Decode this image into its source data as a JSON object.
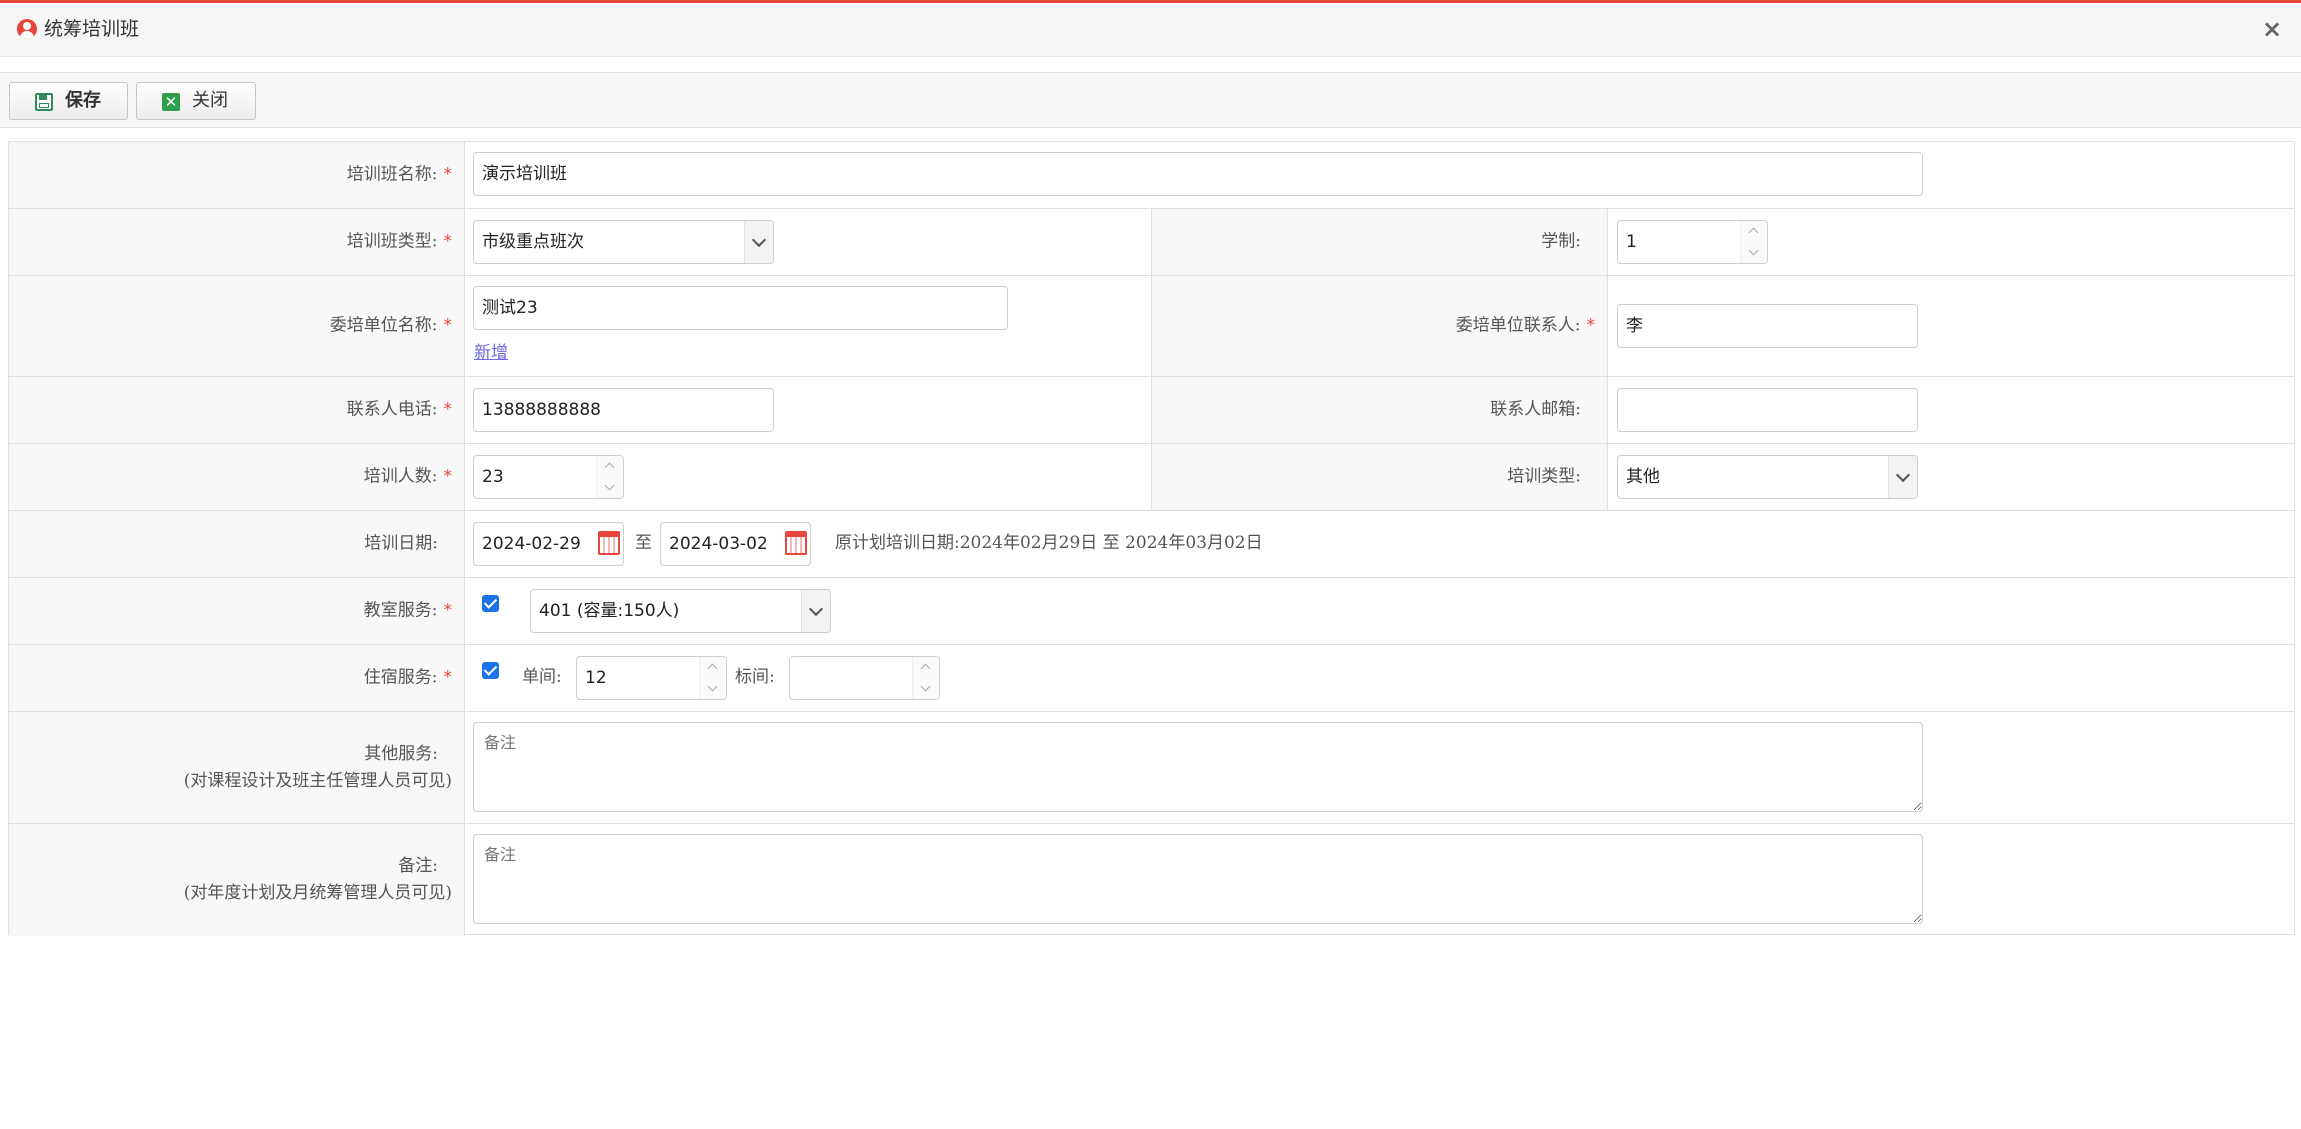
{
  "window": {
    "title": "统筹培训班",
    "close_glyph": "×"
  },
  "toolbar": {
    "save_label": "保存",
    "close_label": "关闭"
  },
  "form": {
    "name": {
      "label": "培训班名称:",
      "value": "演示培训班"
    },
    "type": {
      "label": "培训班类型:",
      "value": "市级重点班次"
    },
    "duration": {
      "label": "学制:",
      "value": "1"
    },
    "unit": {
      "label": "委培单位名称:",
      "value": "测试23",
      "add_link": "新增"
    },
    "unit_contact": {
      "label": "委培单位联系人:",
      "value": "李"
    },
    "phone": {
      "label": "联系人电话:",
      "value": "13888888888"
    },
    "email": {
      "label": "联系人邮箱:",
      "value": ""
    },
    "count": {
      "label": "培训人数:",
      "value": "23"
    },
    "training_type": {
      "label": "培训类型:",
      "value": "其他"
    },
    "dates": {
      "label": "培训日期:",
      "start": "2024-02-29",
      "sep": "至",
      "end": "2024-03-02",
      "original_plan": "原计划培训日期:2024年02月29日 至 2024年03月02日"
    },
    "classroom": {
      "label": "教室服务:",
      "checked": true,
      "room": "401 (容量:150人)"
    },
    "lodging": {
      "label": "住宿服务:",
      "checked": true,
      "single_label": "单间:",
      "single_value": "12",
      "standard_label": "标间:",
      "standard_value": ""
    },
    "other_service": {
      "label": "其他服务:",
      "sublabel": "(对课程设计及班主任管理人员可见)",
      "placeholder": "备注"
    },
    "remark": {
      "label": "备注:",
      "sublabel": "(对年度计划及月统筹管理人员可见)",
      "placeholder": "备注"
    }
  },
  "colors": {
    "accent": "#e8453c",
    "checkbox": "#1a73e8",
    "save_icon": "#2e8b57",
    "close_icon": "#2e9e4a"
  }
}
